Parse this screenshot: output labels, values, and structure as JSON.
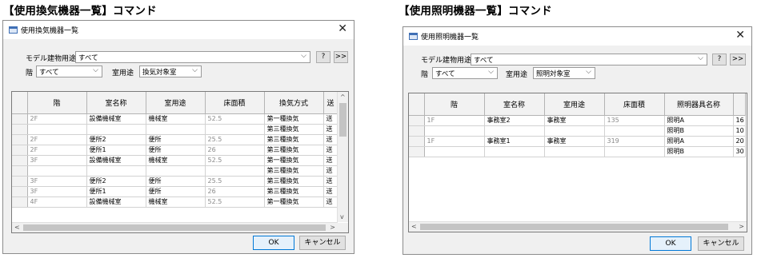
{
  "captions": {
    "left": "【使用換気機器一覧】コマンド",
    "right": "【使用照明機器一覧】コマンド"
  },
  "ventilation_dialog": {
    "title": "使用換気機器一覧",
    "model_usage_label": "モデル建物用途",
    "model_usage_value": "すべて",
    "help_button": "?",
    "more_button": ">>",
    "floor_label": "階",
    "floor_value": "すべて",
    "room_usage_label": "室用途",
    "room_usage_value": "換気対象室",
    "columns": [
      "階",
      "室名称",
      "室用途",
      "床面積",
      "換気方式",
      "送"
    ],
    "rows": [
      [
        "2F",
        "設備機械室",
        "機械室",
        "52.5",
        "第一種換気",
        "送"
      ],
      [
        "",
        "",
        "",
        "",
        "第三種換気",
        "送"
      ],
      [
        "2F",
        "便所2",
        "便所",
        "25.5",
        "第三種換気",
        "送"
      ],
      [
        "2F",
        "便所1",
        "便所",
        "26",
        "第三種換気",
        "送"
      ],
      [
        "3F",
        "設備機械室",
        "機械室",
        "52.5",
        "第一種換気",
        "送"
      ],
      [
        "",
        "",
        "",
        "",
        "第三種換気",
        "送"
      ],
      [
        "3F",
        "便所2",
        "便所",
        "25.5",
        "第三種換気",
        "送"
      ],
      [
        "3F",
        "便所1",
        "便所",
        "26",
        "第三種換気",
        "送"
      ],
      [
        "4F",
        "設備機械室",
        "機械室",
        "52.5",
        "第一種換気",
        "送"
      ]
    ],
    "ok_button": "OK",
    "cancel_button": "キャンセル"
  },
  "lighting_dialog": {
    "title": "使用照明機器一覧",
    "model_usage_label": "モデル建物用途",
    "model_usage_value": "すべて",
    "help_button": "?",
    "more_button": ">>",
    "floor_label": "階",
    "floor_value": "すべて",
    "room_usage_label": "室用途",
    "room_usage_value": "照明対象室",
    "columns": [
      "階",
      "室名称",
      "室用途",
      "床面積",
      "照明器具名称",
      ""
    ],
    "rows": [
      [
        "1F",
        "事務室2",
        "事務室",
        "135",
        "照明A",
        "16"
      ],
      [
        "",
        "",
        "",
        "",
        "照明B",
        "10"
      ],
      [
        "1F",
        "事務室1",
        "事務室",
        "319",
        "照明A",
        "20"
      ],
      [
        "",
        "",
        "",
        "",
        "照明B",
        "30"
      ]
    ],
    "ok_button": "OK",
    "cancel_button": "キャンセル"
  }
}
